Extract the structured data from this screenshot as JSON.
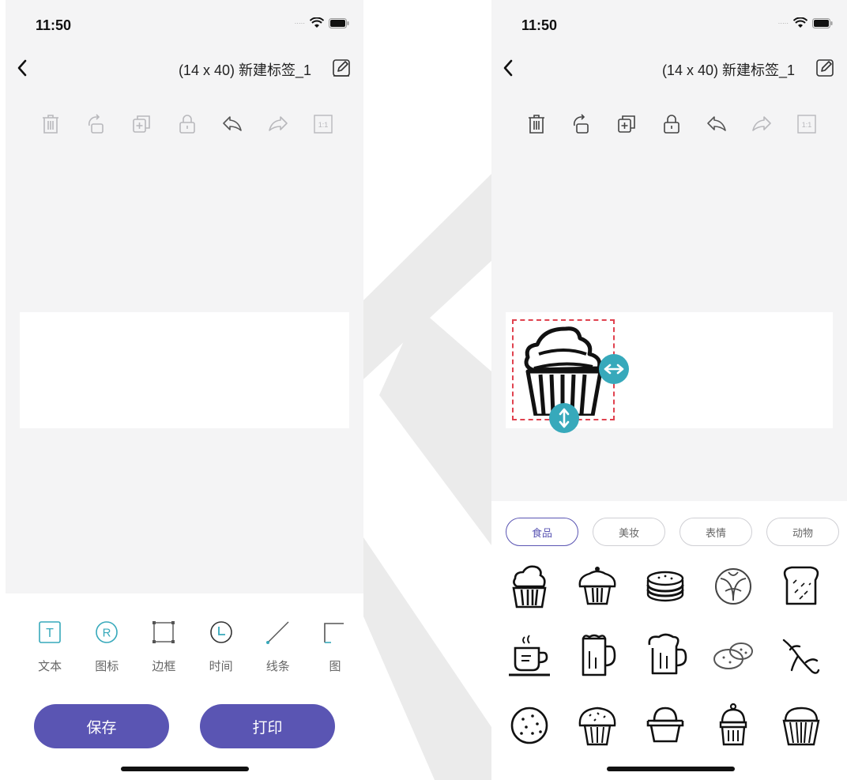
{
  "status": {
    "time": "11:50"
  },
  "header": {
    "title": "(14 x 40) 新建标签_1"
  },
  "toolbar": {
    "icons": [
      "delete-icon",
      "rotate-icon",
      "duplicate-icon",
      "lock-icon",
      "undo-icon",
      "redo-icon",
      "actual-size-icon"
    ],
    "ratio_label": "1:1"
  },
  "elements": [
    {
      "label": "文本",
      "icon": "text-icon",
      "glyph": "T"
    },
    {
      "label": "图标",
      "icon": "registered-icon",
      "glyph": "R"
    },
    {
      "label": "边框",
      "icon": "border-icon"
    },
    {
      "label": "时间",
      "icon": "clock-icon"
    },
    {
      "label": "线条",
      "icon": "line-icon"
    },
    {
      "label": "图",
      "icon": "image-icon"
    }
  ],
  "actions": {
    "save": "保存",
    "print": "打印"
  },
  "sticker_tabs": [
    {
      "label": "食品",
      "active": true
    },
    {
      "label": "美妆",
      "active": false
    },
    {
      "label": "表情",
      "active": false
    },
    {
      "label": "动物",
      "active": false
    }
  ],
  "stickers": [
    "cupcake-icon",
    "muffin-icon",
    "cookies-stack-icon",
    "cabbage-icon",
    "bread-slice-icon",
    "coffee-cup-icon",
    "beer-mug-icon",
    "beer-mug-foam-icon",
    "potato-icon",
    "ginseng-icon",
    "cookie-icon",
    "sprinkle-muffin-icon",
    "pudding-icon",
    "cherry-cupcake-icon",
    "cupcake-liner-icon"
  ],
  "colors": {
    "accent": "#5a55b3",
    "handle": "#37a9bb",
    "selection": "#e0424f"
  }
}
